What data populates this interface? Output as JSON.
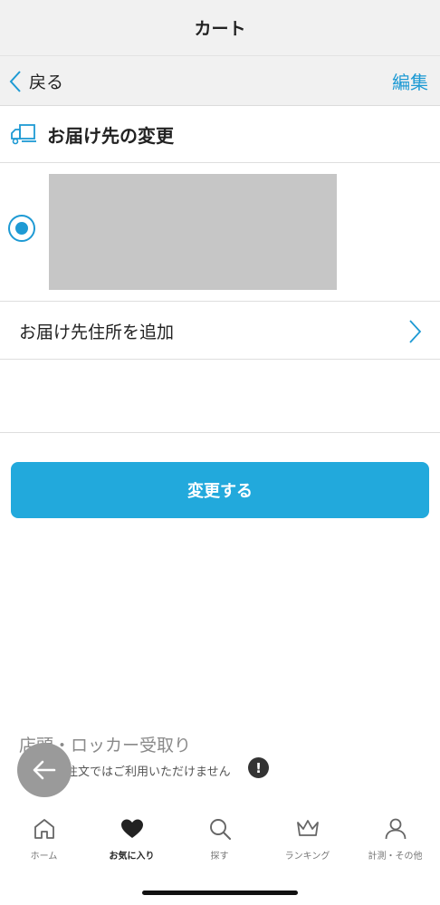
{
  "header": {
    "title": "カート"
  },
  "nav": {
    "back_label": "戻る",
    "edit_label": "編集"
  },
  "section": {
    "title": "お届け先の変更"
  },
  "address": {
    "selected": true
  },
  "add_address": {
    "label": "お届け先住所を追加"
  },
  "locker": {
    "label": "店頭・ロッカー受取り",
    "note": "今回のご注文ではご利用いただけません",
    "alert_glyph": "!"
  },
  "primary_action": {
    "label": "変更する"
  },
  "tabs": [
    {
      "label": "ホーム",
      "icon": "home-icon",
      "active": false
    },
    {
      "label": "お気に入り",
      "icon": "heart-icon",
      "active": true
    },
    {
      "label": "探す",
      "icon": "search-icon",
      "active": false
    },
    {
      "label": "ランキング",
      "icon": "crown-icon",
      "active": false
    },
    {
      "label": "計測・その他",
      "icon": "person-icon",
      "active": false
    }
  ],
  "colors": {
    "accent": "#22a9dc",
    "link": "#1e9ad4",
    "bar_bg": "#f1f1f1"
  }
}
